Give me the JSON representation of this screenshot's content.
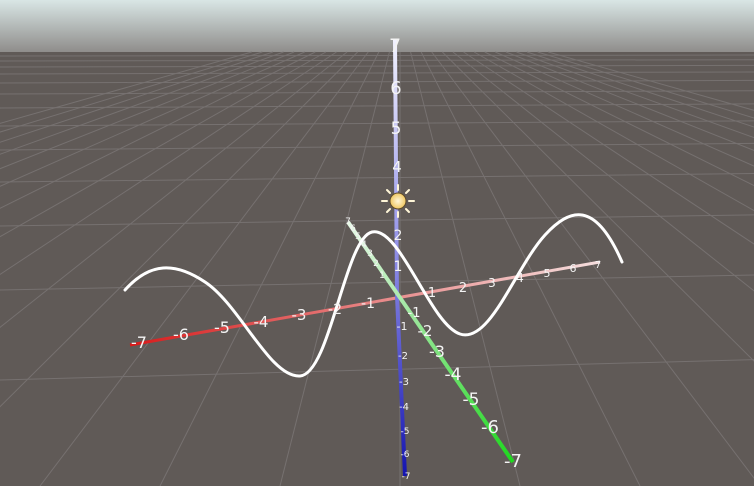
{
  "scene": {
    "colors": {
      "sky": "#cfe0df",
      "ground": "#605a57",
      "grid": "#767170",
      "x_axis_neg": "#d81b1b",
      "x_axis_pos": "#f1c9c9",
      "y_axis_pos": "#ecebff",
      "y_axis_neg": "#1d1db8",
      "z_axis_near": "#1fdc1f",
      "z_axis_far": "#dff5df",
      "curve": "#ffffff",
      "label": "#f4f4f4"
    },
    "icons": [
      "sun-light-icon"
    ],
    "axes": {
      "x": {
        "labels_negative": [
          "-7",
          "-6",
          "-5",
          "-4",
          "-3",
          "-2",
          "-1"
        ],
        "labels_positive": [
          "1",
          "2",
          "3",
          "4",
          "5",
          "6",
          "7"
        ]
      },
      "y": {
        "labels_positive": [
          "1",
          "2",
          "3",
          "4",
          "5",
          "6",
          "7"
        ],
        "labels_negative": [
          "-1",
          "-2",
          "-3",
          "-4",
          "-5",
          "-6",
          "-7"
        ]
      },
      "z": {
        "labels_near": [
          "-1",
          "-2",
          "-3",
          "-4",
          "-5",
          "-6",
          "-7"
        ],
        "labels_far": [
          "1",
          "2",
          "3",
          "4",
          "5",
          "6",
          "7"
        ]
      }
    }
  }
}
